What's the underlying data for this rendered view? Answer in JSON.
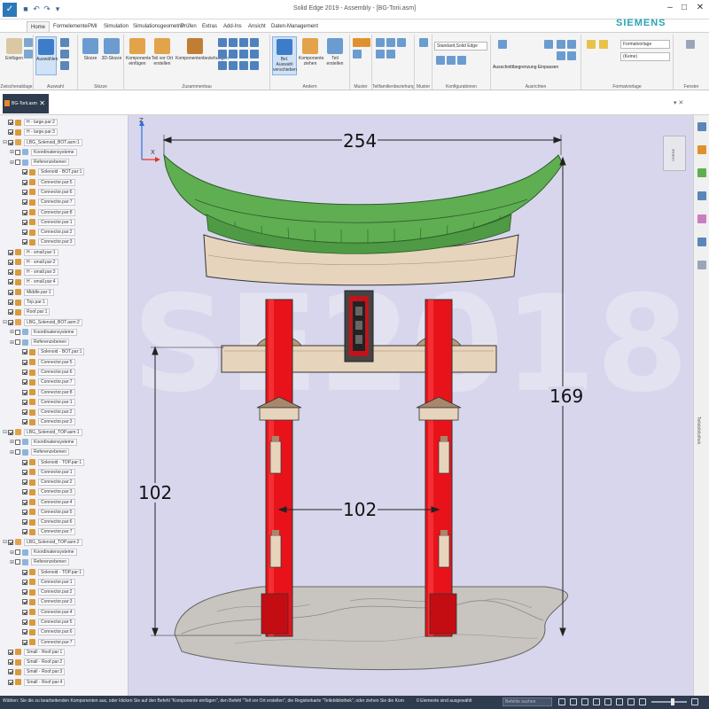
{
  "window": {
    "title": "Solid Edge 2019 - Assembly - [BG-Torii.asm]",
    "minimize": "–",
    "maximize": "□",
    "close": "✕"
  },
  "tabs": [
    {
      "label": "Home",
      "active": true
    },
    {
      "label": "Formelemente"
    },
    {
      "label": "PMI"
    },
    {
      "label": "Simulation"
    },
    {
      "label": "Simulationsgeometrie"
    },
    {
      "label": "Prüfen"
    },
    {
      "label": "Extras"
    },
    {
      "label": "Add-Ins"
    },
    {
      "label": "Ansicht"
    },
    {
      "label": "Daten-Management"
    }
  ],
  "brand": "SIEMENS",
  "ribbon": {
    "groups": [
      {
        "label": "Zwischenablage"
      },
      {
        "label": "Auswahl"
      },
      {
        "label": "Skizze"
      },
      {
        "label": "Zusammenbau"
      },
      {
        "label": "Ändern"
      },
      {
        "label": "Muster"
      },
      {
        "label": "Teilfamilienbeziehung"
      },
      {
        "label": "Muster"
      },
      {
        "label": "Konfigurationen"
      },
      {
        "label": "Ausrichten"
      },
      {
        "label": "Formatvorlage"
      },
      {
        "label": "Fenster"
      }
    ],
    "buttons": {
      "paste": "Einfügen",
      "select": "Auswählen",
      "sketch": "Skizze",
      "sketch3d": "3D-Skizze",
      "insert_component": "Komponente einfügen",
      "part_in_place": "Teil vor Ort erstellen",
      "assembly_relations": "Komponentenbeziehungen",
      "move_component": "Bel. Auswahl verschieben",
      "component_move": "Komponente ziehen",
      "part_create": "Teil erstellen"
    },
    "config_combo": "Standard,Solid Edge",
    "style_combo": "Formatvorlage",
    "layer_combo": "(Keine)",
    "align_label": "Ausschnittbegrenzung  Einpassen"
  },
  "document_tab": {
    "label": "BG-Torii.asm",
    "close": "✕"
  },
  "pane_controls": "▾ ✕",
  "tree": [
    {
      "indent": 1,
      "label": "H - large.par:2",
      "checked": true,
      "color": "#d89a3c"
    },
    {
      "indent": 1,
      "label": "H - large.par:3",
      "checked": true,
      "color": "#d89a3c"
    },
    {
      "indent": 1,
      "label": "LBG_Solenoid_BOT.asm:1",
      "checked": true,
      "color": "#e2a34a",
      "exp": "⊟"
    },
    {
      "indent": 2,
      "label": "Koordinatensysteme",
      "checked": false,
      "color": "#8fb4d8",
      "exp": "⊞"
    },
    {
      "indent": 2,
      "label": "Referenzebenen",
      "checked": false,
      "color": "#8fb4d8",
      "exp": "⊞"
    },
    {
      "indent": 3,
      "label": "Solenoid - BOT.par:1",
      "checked": true,
      "color": "#d89a3c"
    },
    {
      "indent": 3,
      "label": "Connector.par:5",
      "checked": true,
      "color": "#d89a3c"
    },
    {
      "indent": 3,
      "label": "Connector.par:6",
      "checked": true,
      "color": "#d89a3c"
    },
    {
      "indent": 3,
      "label": "Connector.par:7",
      "checked": true,
      "color": "#d89a3c"
    },
    {
      "indent": 3,
      "label": "Connector.par:8",
      "checked": true,
      "color": "#d89a3c"
    },
    {
      "indent": 3,
      "label": "Connector.par:1",
      "checked": true,
      "color": "#d89a3c"
    },
    {
      "indent": 3,
      "label": "Connector.par:2",
      "checked": true,
      "color": "#d89a3c"
    },
    {
      "indent": 3,
      "label": "Connector.par:3",
      "checked": true,
      "color": "#d89a3c"
    },
    {
      "indent": 1,
      "label": "H - small.par:1",
      "checked": true,
      "color": "#d89a3c"
    },
    {
      "indent": 1,
      "label": "H - small.par:2",
      "checked": true,
      "color": "#d89a3c"
    },
    {
      "indent": 1,
      "label": "H - small.par:3",
      "checked": true,
      "color": "#d89a3c"
    },
    {
      "indent": 1,
      "label": "H - small.par:4",
      "checked": true,
      "color": "#d89a3c"
    },
    {
      "indent": 1,
      "label": "Middle.par:1",
      "checked": true,
      "color": "#d89a3c"
    },
    {
      "indent": 1,
      "label": "Top.par:1",
      "checked": true,
      "color": "#d89a3c"
    },
    {
      "indent": 1,
      "label": "Roof.par:1",
      "checked": true,
      "color": "#d89a3c"
    },
    {
      "indent": 1,
      "label": "LBG_Solenoid_BOT.asm:2",
      "checked": true,
      "color": "#e2a34a",
      "exp": "⊟"
    },
    {
      "indent": 2,
      "label": "Koordinatensysteme",
      "checked": false,
      "color": "#8fb4d8",
      "exp": "⊞"
    },
    {
      "indent": 2,
      "label": "Referenzebenen",
      "checked": false,
      "color": "#8fb4d8",
      "exp": "⊞"
    },
    {
      "indent": 3,
      "label": "Solenoid - BOT.par:1",
      "checked": true,
      "color": "#d89a3c"
    },
    {
      "indent": 3,
      "label": "Connector.par:5",
      "checked": true,
      "color": "#d89a3c"
    },
    {
      "indent": 3,
      "label": "Connector.par:6",
      "checked": true,
      "color": "#d89a3c"
    },
    {
      "indent": 3,
      "label": "Connector.par:7",
      "checked": true,
      "color": "#d89a3c"
    },
    {
      "indent": 3,
      "label": "Connector.par:8",
      "checked": true,
      "color": "#d89a3c"
    },
    {
      "indent": 3,
      "label": "Connector.par:1",
      "checked": true,
      "color": "#d89a3c"
    },
    {
      "indent": 3,
      "label": "Connector.par:2",
      "checked": true,
      "color": "#d89a3c"
    },
    {
      "indent": 3,
      "label": "Connector.par:3",
      "checked": true,
      "color": "#d89a3c"
    },
    {
      "indent": 1,
      "label": "LBG_Solenoid_TOP.asm:1",
      "checked": true,
      "color": "#e2a34a",
      "exp": "⊟"
    },
    {
      "indent": 2,
      "label": "Koordinatensysteme",
      "checked": false,
      "color": "#8fb4d8",
      "exp": "⊞"
    },
    {
      "indent": 2,
      "label": "Referenzebenen",
      "checked": false,
      "color": "#8fb4d8",
      "exp": "⊞"
    },
    {
      "indent": 3,
      "label": "Solenoid - TOP.par:1",
      "checked": true,
      "color": "#d89a3c"
    },
    {
      "indent": 3,
      "label": "Connector.par:1",
      "checked": true,
      "color": "#d89a3c"
    },
    {
      "indent": 3,
      "label": "Connector.par:2",
      "checked": true,
      "color": "#d89a3c"
    },
    {
      "indent": 3,
      "label": "Connector.par:3",
      "checked": true,
      "color": "#d89a3c"
    },
    {
      "indent": 3,
      "label": "Connector.par:4",
      "checked": true,
      "color": "#d89a3c"
    },
    {
      "indent": 3,
      "label": "Connector.par:5",
      "checked": true,
      "color": "#d89a3c"
    },
    {
      "indent": 3,
      "label": "Connector.par:6",
      "checked": true,
      "color": "#d89a3c"
    },
    {
      "indent": 3,
      "label": "Connector.par:7",
      "checked": true,
      "color": "#d89a3c"
    },
    {
      "indent": 1,
      "label": "LBG_Solenoid_TOP.asm:2",
      "checked": true,
      "color": "#e2a34a",
      "exp": "⊟"
    },
    {
      "indent": 2,
      "label": "Koordinatensysteme",
      "checked": false,
      "color": "#8fb4d8",
      "exp": "⊞"
    },
    {
      "indent": 2,
      "label": "Referenzebenen",
      "checked": false,
      "color": "#8fb4d8",
      "exp": "⊞"
    },
    {
      "indent": 3,
      "label": "Solenoid - TOP.par:1",
      "checked": true,
      "color": "#d89a3c"
    },
    {
      "indent": 3,
      "label": "Connector.par:1",
      "checked": true,
      "color": "#d89a3c"
    },
    {
      "indent": 3,
      "label": "Connector.par:2",
      "checked": true,
      "color": "#d89a3c"
    },
    {
      "indent": 3,
      "label": "Connector.par:3",
      "checked": true,
      "color": "#d89a3c"
    },
    {
      "indent": 3,
      "label": "Connector.par:4",
      "checked": true,
      "color": "#d89a3c"
    },
    {
      "indent": 3,
      "label": "Connector.par:5",
      "checked": true,
      "color": "#d89a3c"
    },
    {
      "indent": 3,
      "label": "Connector.par:6",
      "checked": true,
      "color": "#d89a3c"
    },
    {
      "indent": 3,
      "label": "Connector.par:7",
      "checked": true,
      "color": "#d89a3c"
    },
    {
      "indent": 1,
      "label": "Small - Roof.par:1",
      "checked": true,
      "color": "#d89a3c"
    },
    {
      "indent": 1,
      "label": "Small - Roof.par:2",
      "checked": true,
      "color": "#d89a3c"
    },
    {
      "indent": 1,
      "label": "Small - Roof.par:3",
      "checked": true,
      "color": "#d89a3c"
    },
    {
      "indent": 1,
      "label": "Small - Roof.par:4",
      "checked": true,
      "color": "#d89a3c"
    }
  ],
  "dimensions": {
    "width_top": "254",
    "height_total": "169",
    "height_lower": "102",
    "span_pillars": "102"
  },
  "watermark": "SE2018",
  "view_cube": "VORNE",
  "triad": {
    "z": "Z",
    "x": "X"
  },
  "right_panel_label": "Teilebibliothek",
  "status": {
    "message": "Wählen: Sie die zu bearbeitenden Komponenten aus, oder klicken Sie auf den Befehl \"Komponente einfügen\", den Befehl \"Teil vor Ort erstellen\", die Registerkarte \"Teilebibliothek\", oder ziehen Sie die Kom",
    "selection": "0 Elemente sind ausgewählt",
    "search_placeholder": "Befehle suchen"
  },
  "colors": {
    "roof": "#5fae52",
    "beam": "#e6d4bc",
    "pillar": "#e8131a",
    "base": "#c8c4c0",
    "viewport": "#d8d6ec",
    "statusbar": "#2f3b4e"
  }
}
